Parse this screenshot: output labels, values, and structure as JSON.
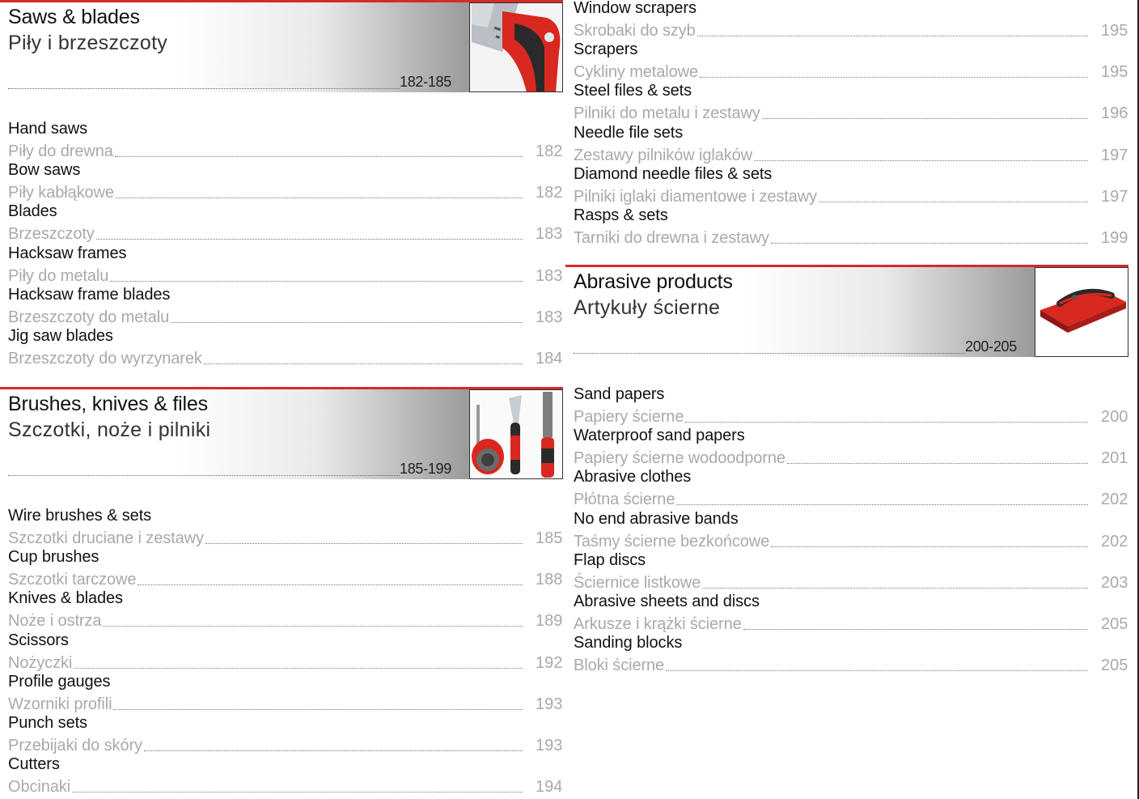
{
  "sections": [
    {
      "title_en": "Saws & blades",
      "title_pl": "Piły i brzeszczoty",
      "range": "182-185",
      "image": "saw-image",
      "items": [
        {
          "en": "Hand saws",
          "pl": "Piły do drewna",
          "page": "182"
        },
        {
          "en": "Bow saws",
          "pl": "Piły kabłąkowe",
          "page": "182"
        },
        {
          "en": "Blades",
          "pl": "Brzeszczoty",
          "page": "183"
        },
        {
          "en": "Hacksaw frames",
          "pl": "Piły do metalu",
          "page": "183"
        },
        {
          "en": "Hacksaw frame blades",
          "pl": "Brzeszczoty do metalu",
          "page": "183"
        },
        {
          "en": "Jig saw blades",
          "pl": "Brzeszczoty do wyrzynarek",
          "page": "184"
        }
      ]
    },
    {
      "title_en": "Brushes, knives & files",
      "title_pl": "Szczotki, noże i pilniki",
      "range": "185-199",
      "image": "brush-knife-file-image",
      "items": [
        {
          "en": "Wire brushes & sets",
          "pl": "Szczotki druciane i zestawy",
          "page": "185"
        },
        {
          "en": "Cup brushes",
          "pl": "Szczotki tarczowe",
          "page": "188"
        },
        {
          "en": "Knives & blades",
          "pl": "Noże i ostrza",
          "page": "189"
        },
        {
          "en": "Scissors",
          "pl": "Nożyczki",
          "page": "192"
        },
        {
          "en": "Profile gauges",
          "pl": "Wzorniki profili",
          "page": "193"
        },
        {
          "en": "Punch sets",
          "pl": "Przebijaki do skóry",
          "page": "193"
        },
        {
          "en": "Cutters",
          "pl": "Obcinaki",
          "page": "194"
        }
      ]
    },
    {
      "title_en": "",
      "title_pl": "",
      "range": "",
      "image": "",
      "items": [
        {
          "en": "Window scrapers",
          "pl": "Skrobaki do szyb",
          "page": "195"
        },
        {
          "en": "Scrapers",
          "pl": "Cykliny metalowe",
          "page": "195"
        },
        {
          "en": "Steel files & sets",
          "pl": "Pilniki do metalu i zestawy",
          "page": "196"
        },
        {
          "en": "Needle file sets",
          "pl": "Zestawy pilników iglaków",
          "page": "197"
        },
        {
          "en": "Diamond needle files & sets",
          "pl": "Pilniki iglaki diamentowe i zestawy",
          "page": "197"
        },
        {
          "en": "Rasps & sets",
          "pl": "Tarniki do drewna i zestawy",
          "page": "199"
        }
      ]
    },
    {
      "title_en": "Abrasive products",
      "title_pl": "Artykuły ścierne",
      "range": "200-205",
      "image": "sanding-block-image",
      "items": [
        {
          "en": "Sand papers",
          "pl": "Papiery ścierne",
          "page": "200"
        },
        {
          "en": "Waterproof sand papers",
          "pl": "Papiery ścierne wodoodporne",
          "page": "201"
        },
        {
          "en": "Abrasive clothes",
          "pl": "Płótna ścierne",
          "page": "202"
        },
        {
          "en": "No end abrasive bands",
          "pl": "Taśmy ścierne bezkońcowe",
          "page": "202"
        },
        {
          "en": "Flap discs",
          "pl": "Ściernice listkowe",
          "page": "203"
        },
        {
          "en": "Abrasive sheets and discs",
          "pl": "Arkusze i krążki ścierne",
          "page": "205"
        },
        {
          "en": "Sanding blocks",
          "pl": "Bloki ścierne",
          "page": "205"
        }
      ]
    }
  ],
  "colors": {
    "accent": "#d62a28",
    "text": "#111111",
    "secondary_text": "#a9a9a9"
  }
}
